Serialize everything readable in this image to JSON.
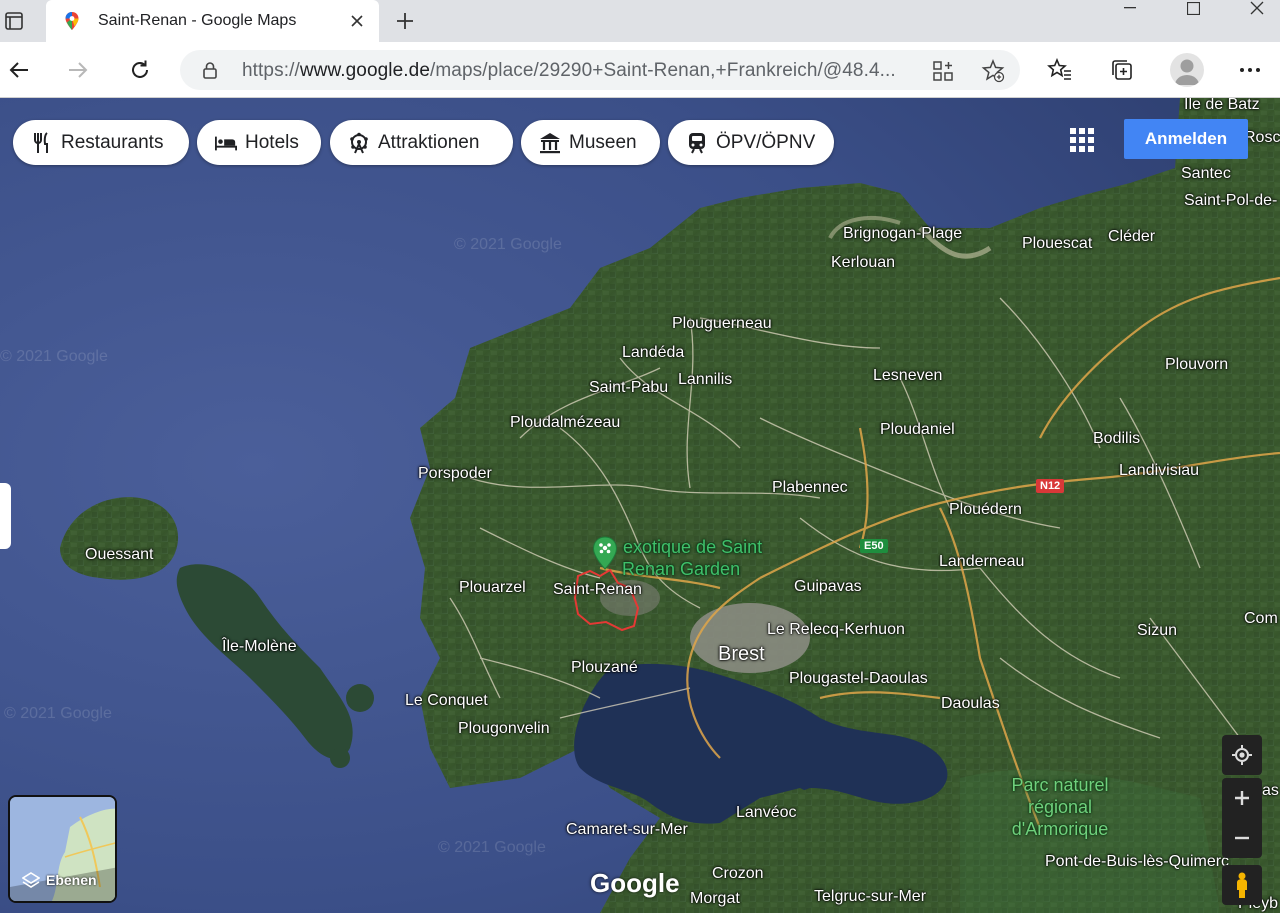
{
  "browser": {
    "tab_title": "Saint-Renan - Google Maps",
    "url_scheme": "https://",
    "url_host": "www.google.de",
    "url_path": "/maps/place/29290+Saint-Renan,+Frankreich/@48.4..."
  },
  "chips": [
    {
      "label": "Restaurants",
      "icon": "fork-knife-icon"
    },
    {
      "label": "Hotels",
      "icon": "bed-icon"
    },
    {
      "label": "Attraktionen",
      "icon": "ferris-wheel-icon"
    },
    {
      "label": "Museen",
      "icon": "museum-icon"
    },
    {
      "label": "ÖPV/ÖPNV",
      "icon": "train-icon"
    }
  ],
  "signin_label": "Anmelden",
  "layers_label": "Ebenen",
  "logo_text": "Google",
  "watermark": "© 2021 Google",
  "roads": {
    "n12": "N12",
    "e50": "E50"
  },
  "places": {
    "ile_de_batz": "Île de Batz",
    "roscoff": "Roscoff",
    "santec": "Santec",
    "saint_pol": "Saint-Pol-de-",
    "brignogan": "Brignogan-Plage",
    "kerlouan": "Kerlouan",
    "plouescat": "Plouescat",
    "cleder": "Cléder",
    "plouguerneau": "Plouguerneau",
    "landeda": "Landéda",
    "saint_pabu": "Saint-Pabu",
    "lannilis": "Lannilis",
    "lesneven": "Lesneven",
    "plouvorn": "Plouvorn",
    "ploudalmezeau": "Ploudalmézeau",
    "ploudaniel": "Ploudaniel",
    "bodilis": "Bodilis",
    "porspoder": "Porspoder",
    "landivisiau": "Landivisiau",
    "plabennec": "Plabennec",
    "plouedern": "Plouédern",
    "ouessant": "Ouessant",
    "garden_line1": "exotique de Saint",
    "garden_line2": "Renan Garden",
    "landerneau": "Landerneau",
    "plouarzel": "Plouarzel",
    "saint_renan": "Saint-Renan",
    "guipavas": "Guipavas",
    "commana": "Com",
    "le_relecq": "Le Relecq-Kerhuon",
    "sizun": "Sizun",
    "ile_molene": "Île-Molène",
    "brest": "Brest",
    "plouzane": "Plouzané",
    "plougastel": "Plougastel-Daoulas",
    "le_conquet": "Le Conquet",
    "daoulas": "Daoulas",
    "plougonvelin": "Plougonvelin",
    "parc_line1": "Parc naturel",
    "parc_line2": "régional",
    "parc_line3": "d'Armorique",
    "lanveoc": "Lanvéoc",
    "camaret": "Camaret-sur-Mer",
    "pont_de_buis": "Pont-de-Buis-lès-Quimerc",
    "crozon": "Crozon",
    "morgat": "Morgat",
    "telgruc": "Telgruc-sur-Mer",
    "pleyben": "Pleyb",
    "as_right": "as"
  },
  "colors": {
    "sea": "#3a4f86",
    "land": "#3b5a2e",
    "road": "#e8e0c8",
    "major_road": "#e0a64a",
    "signin_bg": "#4285f4",
    "route_outline": "#e53935",
    "poi_green": "#34a853"
  }
}
